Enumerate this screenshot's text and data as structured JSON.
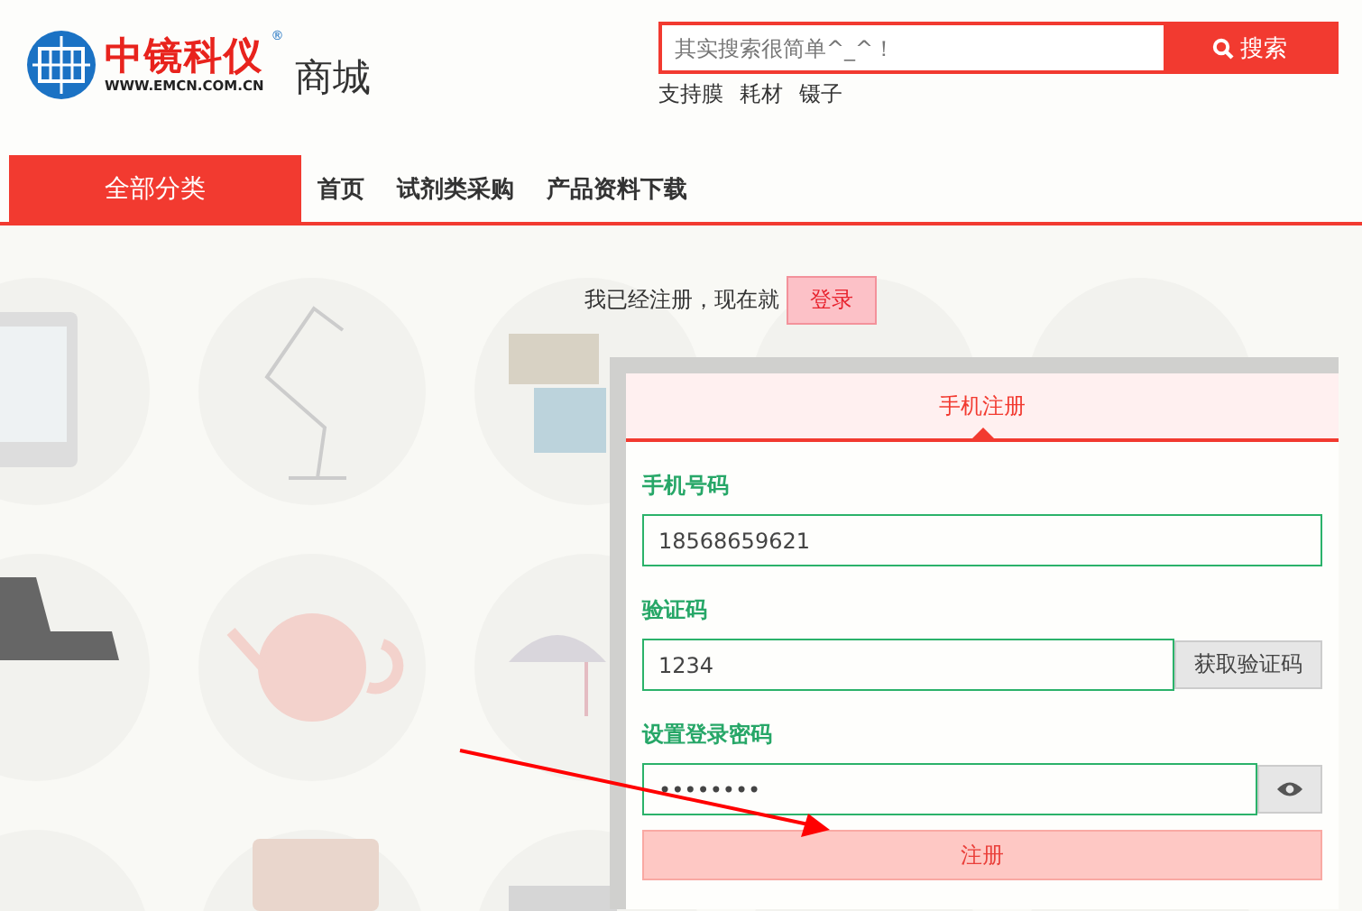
{
  "header": {
    "logo": {
      "brand": "中镜科仪",
      "url": "WWW.EMCN.COM.CN",
      "mark": "®"
    },
    "site_name": "商城",
    "search": {
      "placeholder": "其实搜索很简单^_^！",
      "button": "搜索"
    },
    "hot_tags": [
      "支持膜",
      "耗材",
      "镊子"
    ]
  },
  "nav": {
    "category": "全部分类",
    "links": [
      "首页",
      "试剂类采购",
      "产品资料下载"
    ]
  },
  "login_prompt": {
    "text": "我已经注册，现在就",
    "button": "登录"
  },
  "register": {
    "tabs": [
      {
        "label": "手机注册",
        "selected": true
      }
    ],
    "fields": [
      {
        "kind": "text",
        "label": "手机号码",
        "value": "18568659621"
      },
      {
        "kind": "code",
        "label": "验证码",
        "value": "1234",
        "button": "获取验证码"
      },
      {
        "kind": "password",
        "label": "设置登录密码",
        "value": "••••••••"
      }
    ],
    "submit": "注册"
  }
}
